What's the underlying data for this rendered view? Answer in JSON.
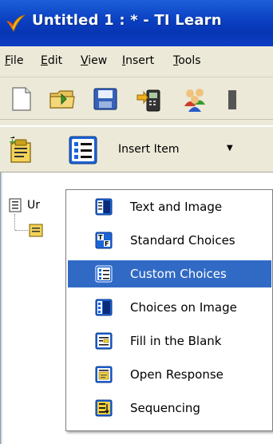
{
  "window": {
    "title": "Untitled 1 :  * - TI Learn"
  },
  "menubar": {
    "items": [
      {
        "label_u": "F",
        "label_rest": "ile"
      },
      {
        "label_u": "E",
        "label_rest": "dit"
      },
      {
        "label_u": "V",
        "label_rest": "iew"
      },
      {
        "label_u": "I",
        "label_rest": "nsert"
      },
      {
        "label_u": "T",
        "label_rest": "ools"
      }
    ]
  },
  "toolbar2": {
    "insert_label": "Insert Item",
    "insert_arrow": "▼"
  },
  "tree": {
    "root_label": "Ur"
  },
  "dropdown": {
    "items": [
      {
        "label": "Text and Image",
        "icon": "text-image-icon",
        "selected": false
      },
      {
        "label": "Standard Choices",
        "icon": "true-false-icon",
        "selected": false
      },
      {
        "label": "Custom Choices",
        "icon": "custom-list-icon",
        "selected": true
      },
      {
        "label": "Choices on Image",
        "icon": "image-choices-icon",
        "selected": false
      },
      {
        "label": "Fill in the Blank",
        "icon": "fill-blank-icon",
        "selected": false
      },
      {
        "label": "Open Response",
        "icon": "open-response-icon",
        "selected": false
      },
      {
        "label": "Sequencing",
        "icon": "sequencing-icon",
        "selected": false
      }
    ]
  },
  "colors": {
    "titlebar": "#0a3fc1",
    "selection": "#316ac5",
    "chrome": "#ece9d8"
  }
}
